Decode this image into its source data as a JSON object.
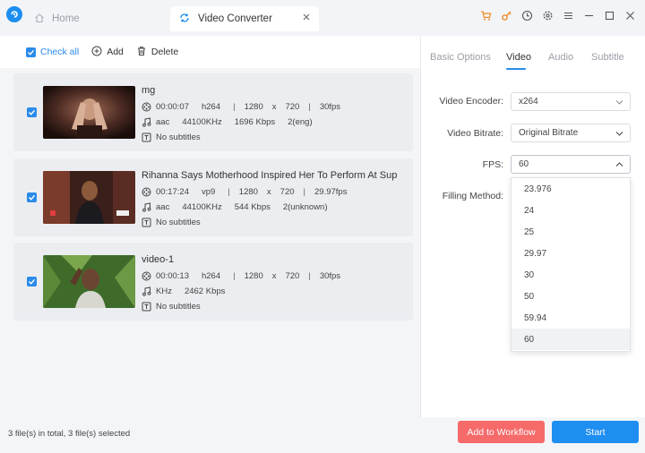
{
  "titlebar": {
    "home_label": "Home",
    "active_tab_label": "Video Converter",
    "icons": [
      "cart-icon",
      "key-icon",
      "clock-icon",
      "gear-icon",
      "menu-icon",
      "minimize-icon",
      "maximize-icon",
      "close-icon"
    ]
  },
  "toolbar": {
    "check_all_label": "Check all",
    "add_label": "Add",
    "delete_label": "Delete"
  },
  "files": [
    {
      "name": "mg",
      "checked": true,
      "duration": "00:00:07",
      "video_codec": "h264",
      "width": "1280",
      "x": "x",
      "height": "720",
      "fps": "30fps",
      "audio_codec": "aac",
      "sample_rate": "44100KHz",
      "audio_bitrate": "1696 Kbps",
      "audio_channels": "2(eng)",
      "subtitles": "No subtitles"
    },
    {
      "name": "Rihanna Says Motherhood Inspired Her To Perform At Supe...",
      "checked": true,
      "duration": "00:17:24",
      "video_codec": "vp9",
      "width": "1280",
      "x": "x",
      "height": "720",
      "fps": "29.97fps",
      "audio_codec": "aac",
      "sample_rate": "44100KHz",
      "audio_bitrate": "544 Kbps",
      "audio_channels": "2(unknown)",
      "subtitles": "No subtitles"
    },
    {
      "name": "video-1",
      "checked": true,
      "duration": "00:00:13",
      "video_codec": "h264",
      "width": "1280",
      "x": "x",
      "height": "720",
      "fps": "30fps",
      "sample_rate": "KHz",
      "audio_bitrate": "2462 Kbps",
      "subtitles": "No subtitles"
    }
  ],
  "sep": "|",
  "settings": {
    "tabs": [
      "Basic Options",
      "Video",
      "Audio",
      "Subtitle"
    ],
    "active_tab": "Video",
    "encoder_label": "Video Encoder:",
    "encoder_value": "x264",
    "bitrate_label": "Video Bitrate:",
    "bitrate_value": "Original Bitrate",
    "fps_label": "FPS:",
    "fps_value": "60",
    "filling_label": "Filling Method:",
    "fps_options": [
      "23.976",
      "24",
      "25",
      "29.97",
      "30",
      "50",
      "59.94",
      "60"
    ],
    "fps_selected": "60"
  },
  "footer": {
    "status": "3 file(s) in total, 3 file(s) selected",
    "workflow_label": "Add to Workflow",
    "start_label": "Start"
  },
  "colors": {
    "accent": "#1f8ef1",
    "workflow": "#f66a6a"
  }
}
